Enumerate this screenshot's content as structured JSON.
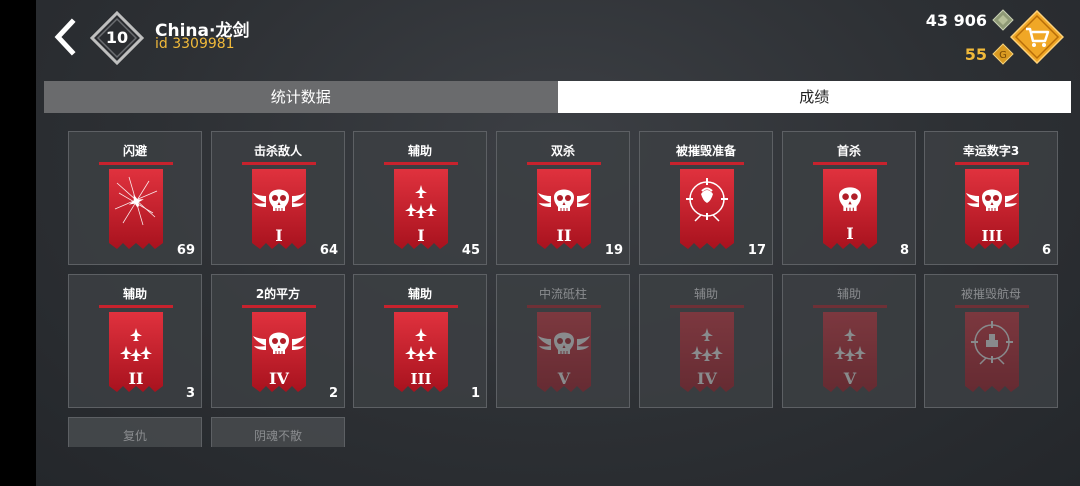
{
  "header": {
    "level": "10",
    "player_name": "China·龙剑",
    "player_id": "id 3309981",
    "silver": "43 906",
    "gold": "55"
  },
  "tabs": [
    {
      "label": "统计数据",
      "active": false
    },
    {
      "label": "成绩",
      "active": true
    }
  ],
  "achievements": [
    {
      "title": "闪避",
      "count": "69",
      "icon": "dodge-icon",
      "rank": "",
      "locked": false
    },
    {
      "title": "击杀敌人",
      "count": "64",
      "icon": "winged-skull-icon",
      "rank": "I",
      "locked": false
    },
    {
      "title": "辅助",
      "count": "45",
      "icon": "jets-icon",
      "rank": "I",
      "locked": false
    },
    {
      "title": "双杀",
      "count": "19",
      "icon": "winged-skull-icon",
      "rank": "II",
      "locked": false
    },
    {
      "title": "被摧毁准备",
      "count": "17",
      "icon": "crosshair-skull-icon",
      "rank": "",
      "locked": false
    },
    {
      "title": "首杀",
      "count": "8",
      "icon": "skull-icon",
      "rank": "I",
      "locked": false
    },
    {
      "title": "幸运数字3",
      "count": "6",
      "icon": "winged-skull-icon",
      "rank": "III",
      "locked": false
    },
    {
      "title": "辅助",
      "count": "3",
      "icon": "jets-icon",
      "rank": "II",
      "locked": false
    },
    {
      "title": "2的平方",
      "count": "2",
      "icon": "winged-skull-icon",
      "rank": "IV",
      "locked": false
    },
    {
      "title": "辅助",
      "count": "1",
      "icon": "jets-icon",
      "rank": "III",
      "locked": false
    },
    {
      "title": "中流砥柱",
      "count": "",
      "icon": "winged-skull-icon",
      "rank": "V",
      "locked": true
    },
    {
      "title": "辅助",
      "count": "",
      "icon": "jets-icon",
      "rank": "IV",
      "locked": true
    },
    {
      "title": "辅助",
      "count": "",
      "icon": "jets-icon",
      "rank": "V",
      "locked": true
    },
    {
      "title": "被摧毁航母",
      "count": "",
      "icon": "crosshair-carrier-icon",
      "rank": "",
      "locked": true
    }
  ],
  "partial_achievements": [
    {
      "title": "复仇"
    },
    {
      "title": "阴魂不散"
    }
  ],
  "colors": {
    "accent_red": "#c7222d",
    "gold": "#f0b93a",
    "tab_active_bg": "#ffffff",
    "tab_inactive_bg": "#6a6b6d"
  }
}
